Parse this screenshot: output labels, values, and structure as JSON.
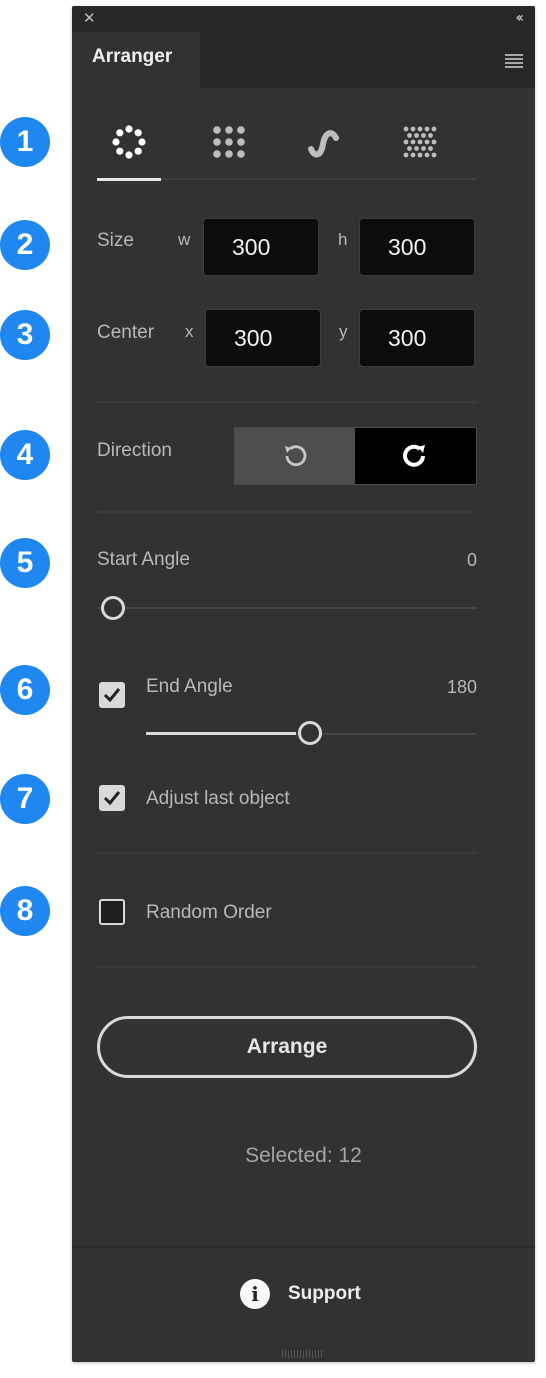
{
  "panel": {
    "close_glyph": "✕",
    "collapse_glyph": "‹‹",
    "tab_title": "Arranger",
    "menu_icon": "hamburger-menu-icon"
  },
  "mode_tabs": [
    {
      "name": "circle-layout",
      "icon": "dotted-circle-icon",
      "active": true
    },
    {
      "name": "grid-layout",
      "icon": "dot-grid-icon",
      "active": false
    },
    {
      "name": "wave-layout",
      "icon": "wave-icon",
      "active": false
    },
    {
      "name": "hex-grid-layout",
      "icon": "hex-dot-grid-icon",
      "active": false
    }
  ],
  "size": {
    "label": "Size",
    "w_label": "w",
    "w_value": "300",
    "h_label": "h",
    "h_value": "300"
  },
  "center": {
    "label": "Center",
    "x_label": "x",
    "x_value": "300",
    "y_label": "y",
    "y_value": "300"
  },
  "direction": {
    "label": "Direction",
    "ccw_icon": "rotate-ccw-icon",
    "cw_icon": "rotate-cw-icon",
    "selected": "clockwise"
  },
  "start_angle": {
    "label": "Start Angle",
    "value": "0",
    "fraction": 0
  },
  "end_angle": {
    "label": "End Angle",
    "value": "180",
    "checked": true,
    "fraction": 0.5
  },
  "adjust_last": {
    "label": "Adjust last object",
    "checked": true
  },
  "random_order": {
    "label": "Random Order",
    "checked": false
  },
  "arrange_button": "Arrange",
  "selected_text": "Selected: 12",
  "support": {
    "label": "Support",
    "icon": "info-icon"
  },
  "badges": [
    "1",
    "2",
    "3",
    "4",
    "5",
    "6",
    "7",
    "8"
  ],
  "colors": {
    "panel_bg": "#323232",
    "field_bg": "#0c0c0c",
    "badge_blue": "#1f87f0",
    "accent_light": "#d9d9d9"
  }
}
